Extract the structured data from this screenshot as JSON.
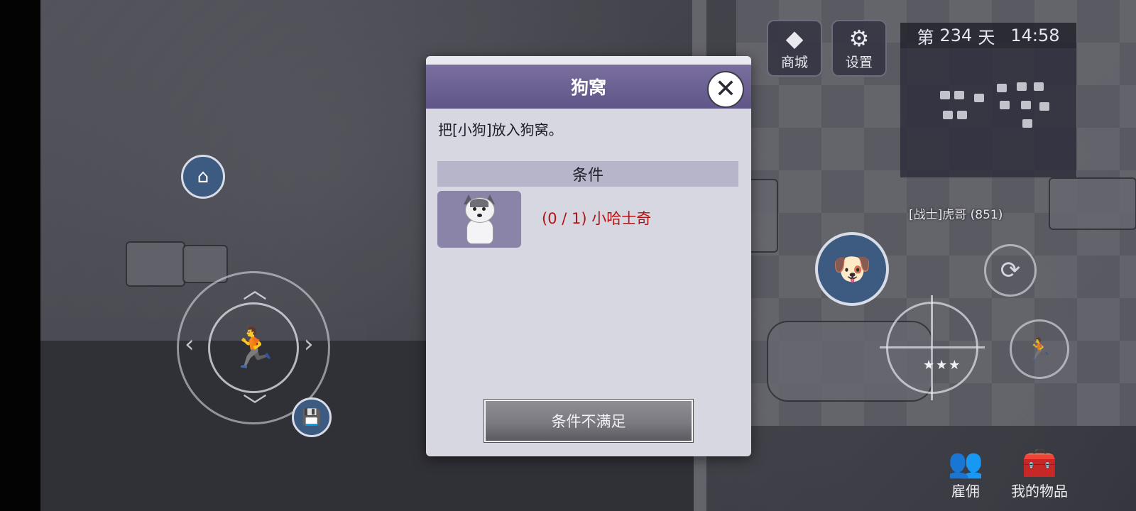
{
  "dialog": {
    "title": "狗窝",
    "description": "把[小狗]放入狗窝。",
    "conditions_header": "条件",
    "requirement": "(0 / 1) 小哈士奇",
    "item_icon": "husky-puppy-icon",
    "action_button": "条件不满足",
    "close_icon": "close-icon"
  },
  "hud": {
    "shop_label": "商城",
    "shop_icon": "diamond-icon",
    "settings_label": "设置",
    "settings_icon": "gear-icon",
    "day_prefix": "第",
    "day_number": "234",
    "day_suffix": "天",
    "time": "14:58",
    "player_tag": "[战士]虎哥 (851)",
    "hire_label": "雇佣",
    "inventory_label": "我的物品"
  },
  "colors": {
    "header_purple": "#6a5f93",
    "requirement_red": "#b01515",
    "hud_blue": "#3d5a80"
  }
}
